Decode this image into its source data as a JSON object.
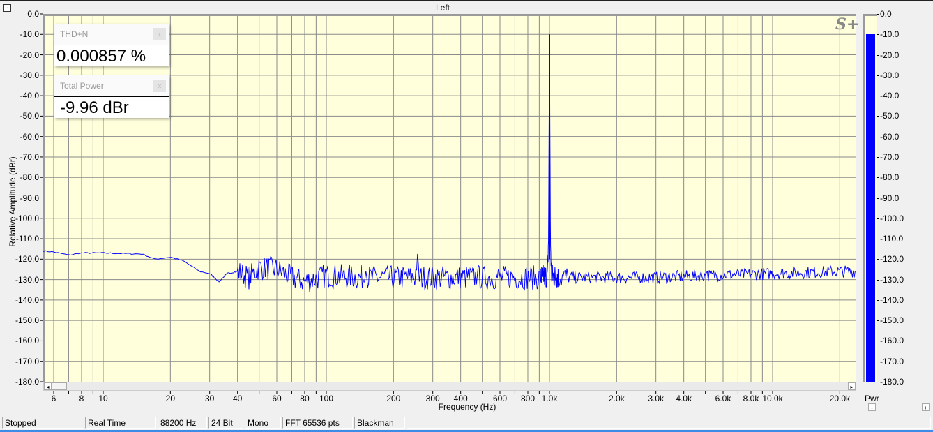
{
  "window": {
    "title": "Left",
    "collapse": "-"
  },
  "panels": [
    {
      "label": "THD+N",
      "value": "0.000857 %",
      "close": "x"
    },
    {
      "label": "Total Power",
      "value": "-9.96 dBr",
      "close": "x"
    }
  ],
  "logo": "S+",
  "meter": {
    "label": "Pwr",
    "value_db": -10,
    "minus": "-",
    "plus": "+",
    "ticks": [
      "0.0",
      "-10.0",
      "-20.0",
      "-30.0",
      "-40.0",
      "-50.0",
      "-60.0",
      "-70.0",
      "-80.0",
      "-90.0",
      "-100.0",
      "-110.0",
      "-120.0",
      "-130.0",
      "-140.0",
      "-150.0",
      "-160.0",
      "-170.0",
      "-180.0"
    ]
  },
  "status": [
    "Stopped",
    "Real Time",
    "88200 Hz",
    "24 Bit",
    "Mono",
    "FFT 65536 pts",
    "Blackman"
  ],
  "chart_data": {
    "type": "line",
    "xlabel": "Frequency (Hz)",
    "ylabel": "Relative Amplitude (dBr)",
    "xscale": "log",
    "xlim": [
      5.4,
      23700
    ],
    "ylim": [
      -180,
      0
    ],
    "grid": true,
    "yticks": [
      "0.0",
      "-10.0",
      "-20.0",
      "-30.0",
      "-40.0",
      "-50.0",
      "-60.0",
      "-70.0",
      "-80.0",
      "-90.0",
      "-100.0",
      "-110.0",
      "-120.0",
      "-130.0",
      "-140.0",
      "-150.0",
      "-160.0",
      "-170.0",
      "-180.0"
    ],
    "xticks": [
      {
        "v": 6,
        "l": "6"
      },
      {
        "v": 8,
        "l": "8"
      },
      {
        "v": 10,
        "l": "10"
      },
      {
        "v": 20,
        "l": "20"
      },
      {
        "v": 30,
        "l": "30"
      },
      {
        "v": 40,
        "l": "40"
      },
      {
        "v": 60,
        "l": "60"
      },
      {
        "v": 80,
        "l": "80"
      },
      {
        "v": 100,
        "l": "100"
      },
      {
        "v": 200,
        "l": "200"
      },
      {
        "v": 300,
        "l": "300"
      },
      {
        "v": 400,
        "l": "400"
      },
      {
        "v": 600,
        "l": "600"
      },
      {
        "v": 800,
        "l": "800"
      },
      {
        "v": 1000,
        "l": "1.0k"
      },
      {
        "v": 2000,
        "l": "2.0k"
      },
      {
        "v": 3000,
        "l": "3.0k"
      },
      {
        "v": 4000,
        "l": "4.0k"
      },
      {
        "v": 6000,
        "l": "6.0k"
      },
      {
        "v": 8000,
        "l": "8.0k"
      },
      {
        "v": 10000,
        "l": "10.0k"
      },
      {
        "v": 20000,
        "l": "20.0k"
      }
    ],
    "series": [
      {
        "name": "Left",
        "color": "#0000ff",
        "noise_spread_db": 6,
        "points": [
          [
            5.4,
            -116
          ],
          [
            6,
            -116.5
          ],
          [
            7,
            -118
          ],
          [
            8,
            -117
          ],
          [
            10,
            -117
          ],
          [
            15,
            -117.5
          ],
          [
            17,
            -120
          ],
          [
            20,
            -119
          ],
          [
            23,
            -121
          ],
          [
            27,
            -126
          ],
          [
            30,
            -127
          ],
          [
            33,
            -131
          ],
          [
            36,
            -127
          ],
          [
            40,
            -126
          ],
          [
            45,
            -129
          ],
          [
            50,
            -124
          ],
          [
            60,
            -125
          ],
          [
            70,
            -129
          ],
          [
            80,
            -131
          ],
          [
            100,
            -128
          ],
          [
            148,
            -129
          ],
          [
            150,
            -118
          ],
          [
            152,
            -129
          ],
          [
            250,
            -129
          ],
          [
            255,
            -120
          ],
          [
            260,
            -129
          ],
          [
            470,
            -129
          ],
          [
            475,
            -123
          ],
          [
            480,
            -129
          ],
          [
            900,
            -129
          ],
          [
            980,
            -128
          ],
          [
            990,
            -110
          ],
          [
            1000,
            -10
          ],
          [
            1010,
            -110
          ],
          [
            1020,
            -128
          ],
          [
            1100,
            -129
          ],
          [
            3000,
            -129
          ],
          [
            5000,
            -128
          ],
          [
            5050,
            -124
          ],
          [
            5100,
            -128
          ],
          [
            10000,
            -127
          ],
          [
            20000,
            -126
          ],
          [
            23700,
            -126
          ]
        ]
      }
    ]
  }
}
